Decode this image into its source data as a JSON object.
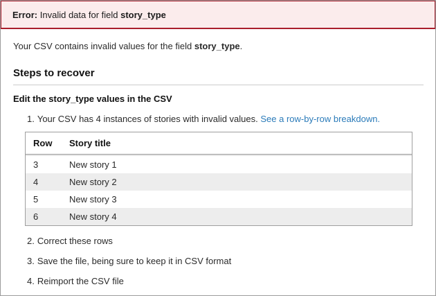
{
  "banner": {
    "label": "Error:",
    "message": "Invalid data for field",
    "field": "story_type"
  },
  "intro": {
    "text": "Your CSV contains invalid values for the field",
    "field": "story_type",
    "suffix": "."
  },
  "section_heading": "Steps to recover",
  "sub_heading": "Edit the story_type values in the CSV",
  "steps": [
    {
      "number": "1.",
      "text": "Your CSV has 4 instances of stories with invalid values.",
      "link": "See a row-by-row breakdown."
    },
    {
      "number": "2.",
      "text": "Correct these rows"
    },
    {
      "number": "3.",
      "text": "Save the file, being sure to keep it in CSV format"
    },
    {
      "number": "4.",
      "text": "Reimport the CSV file"
    }
  ],
  "table": {
    "headers": [
      "Row",
      "Story title"
    ],
    "rows": [
      [
        "3",
        "New story 1"
      ],
      [
        "4",
        "New story 2"
      ],
      [
        "5",
        "New story 3"
      ],
      [
        "6",
        "New story 4"
      ]
    ]
  },
  "colors": {
    "error_border": "#a91e2c",
    "error_background": "#fbecec",
    "link": "#2b7bb9",
    "row_stripe": "#ededed"
  }
}
